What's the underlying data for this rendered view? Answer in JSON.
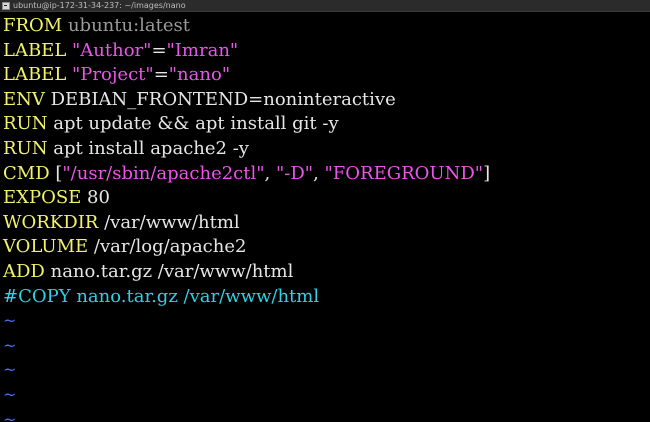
{
  "window": {
    "title": "ubuntu@ip-172-31-34-237: ~/images/nano"
  },
  "colors": {
    "background": "#000000",
    "keyword": "#f3f36b",
    "string": "#ea55ea",
    "comment": "#2fd1e3",
    "tilde": "#4f6df0",
    "text": "#e6e6e6"
  },
  "editor": {
    "lines": [
      {
        "kw": "FROM",
        "rest": " ubuntu:latest"
      },
      {
        "kw": "LABEL",
        "a": " ",
        "s1": "\"Author\"",
        "eq": "=",
        "s2": "\"Imran\""
      },
      {
        "kw": "LABEL",
        "a": " ",
        "s1": "\"Project\"",
        "eq": "=",
        "s2": "\"nano\""
      },
      {
        "kw": "ENV",
        "rest": " DEBIAN_FRONTEND=noninteractive"
      },
      {
        "kw": "RUN",
        "rest": " apt update && apt install git -y"
      },
      {
        "kw": "RUN",
        "rest": " apt install apache2 -y"
      },
      {
        "kw": "CMD",
        "open": " [",
        "s1": "\"/usr/sbin/apache2ctl\"",
        "c1": ", ",
        "s2": "\"-D\"",
        "c2": ", ",
        "s3": "\"FOREGROUND\"",
        "close": "]"
      },
      {
        "kw": "EXPOSE",
        "rest": " 80"
      },
      {
        "kw": "WORKDIR",
        "rest": " /var/www/html"
      },
      {
        "kw": "VOLUME",
        "rest": " /var/log/apache2"
      },
      {
        "kw": "ADD",
        "rest": " nano.tar.gz /var/www/html"
      },
      {
        "comment": "#COPY nano.tar.gz /var/www/html"
      }
    ],
    "empty_marker": "~"
  }
}
